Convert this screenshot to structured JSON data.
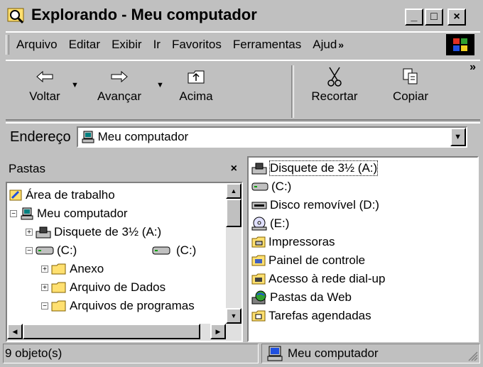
{
  "window": {
    "title": "Explorando - Meu computador"
  },
  "title_buttons": {
    "minimize": "_",
    "maximize": "□",
    "close": "×"
  },
  "menu": {
    "items": [
      {
        "label": "Arquivo"
      },
      {
        "label": "Editar"
      },
      {
        "label": "Exibir"
      },
      {
        "label": "Ir"
      },
      {
        "label": "Favoritos"
      },
      {
        "label": "Ferramentas"
      },
      {
        "label": "Ajuda"
      }
    ],
    "overflow": "»"
  },
  "toolbar": {
    "back": "Voltar",
    "forward": "Avançar",
    "up": "Acima",
    "cut": "Recortar",
    "copy": "Copiar",
    "overflow": "»"
  },
  "address": {
    "label": "Endereço",
    "value": "Meu computador"
  },
  "folders": {
    "title": "Pastas",
    "close": "×",
    "tree": [
      {
        "label": "Área de trabalho",
        "icon": "desktop-icon"
      },
      {
        "label": "Meu computador",
        "icon": "my-computer-icon"
      },
      {
        "label": "Disquete de 3½ (A:)",
        "icon": "floppy-icon"
      },
      {
        "label": "(C:)",
        "icon": "hard-drive-icon"
      },
      {
        "label": "Anexo",
        "icon": "folder-icon"
      },
      {
        "label": "Arquivo de Dados",
        "icon": "folder-icon"
      },
      {
        "label": "Arquivos de programas",
        "icon": "folder-icon"
      }
    ],
    "tooltip": "(C:)"
  },
  "contents": {
    "items": [
      {
        "label": "Disquete de 3½ (A:)",
        "icon": "floppy-icon"
      },
      {
        "label": "(C:)",
        "icon": "hard-drive-icon"
      },
      {
        "label": "Disco removível (D:)",
        "icon": "removable-disk-icon"
      },
      {
        "label": "(E:)",
        "icon": "cd-drive-icon"
      },
      {
        "label": "Impressoras",
        "icon": "printers-folder-icon"
      },
      {
        "label": "Painel de controle",
        "icon": "control-panel-icon"
      },
      {
        "label": "Acesso à rede dial-up",
        "icon": "dialup-icon"
      },
      {
        "label": "Pastas da Web",
        "icon": "web-folders-icon"
      },
      {
        "label": "Tarefas agendadas",
        "icon": "scheduled-tasks-icon"
      }
    ]
  },
  "status": {
    "count": "9 objeto(s)",
    "location": "Meu computador"
  }
}
